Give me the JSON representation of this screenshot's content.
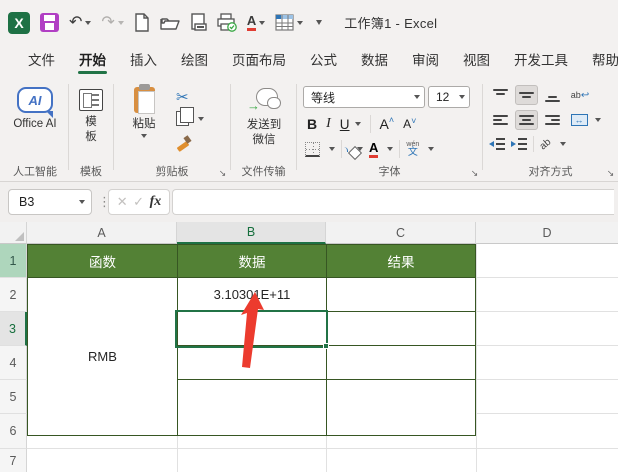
{
  "title_bar": {
    "title": "工作簿1 - Excel"
  },
  "tabs": [
    {
      "label": "文件"
    },
    {
      "label": "开始"
    },
    {
      "label": "插入"
    },
    {
      "label": "绘图"
    },
    {
      "label": "页面布局"
    },
    {
      "label": "公式"
    },
    {
      "label": "数据"
    },
    {
      "label": "审阅"
    },
    {
      "label": "视图"
    },
    {
      "label": "开发工具"
    },
    {
      "label": "帮助"
    }
  ],
  "ribbon": {
    "ai_group": {
      "label": "人工智能",
      "office_ai": "Office AI"
    },
    "template_group": {
      "label": "模板",
      "template": "模板"
    },
    "clipboard_group": {
      "label": "剪贴板",
      "paste": "粘贴"
    },
    "transfer_group": {
      "label": "文件传输",
      "send_wechat": "发送到微信"
    },
    "font_group": {
      "label": "字体",
      "font_name": "等线",
      "font_size": "12"
    },
    "alignment_group": {
      "label": "对齐方式"
    }
  },
  "formula_bar": {
    "name_box_value": "B3",
    "formula_value": ""
  },
  "grid": {
    "col_headers": [
      "A",
      "B",
      "C",
      "D"
    ],
    "row_headers": [
      "1",
      "2",
      "3",
      "4",
      "5",
      "6",
      "7"
    ],
    "table": {
      "a1": "函数",
      "b1": "数据",
      "c1": "结果",
      "b2": "3.10301E+11",
      "a2_merged": "RMB"
    },
    "selected_cell": "B3"
  },
  "icons": {
    "excel_logo": "X",
    "undo": "↶",
    "redo": "↷",
    "scissors": "✂",
    "dots": "⋮",
    "cancel": "✕",
    "check": "✓",
    "fx": "fx",
    "ai": "AI",
    "bold": "B",
    "italic": "I",
    "underline": "U",
    "font_letter": "A",
    "grow_caret": "˄",
    "shrink_caret": "˅",
    "phonetic_top": "wén",
    "phonetic_bottom": "文",
    "wrap_ab": "ab",
    "orient_ab": "ab",
    "merge_arrows": "↔",
    "wechat_arrow": "→",
    "launcher": "↘"
  },
  "colors": {
    "excel_green": "#217346",
    "table_header_fill": "#538135",
    "table_border": "#375623",
    "arrow_red": "#ec3b2e",
    "save_icon_purple": "#b13fc4",
    "accent_blue": "#2e75b6"
  }
}
